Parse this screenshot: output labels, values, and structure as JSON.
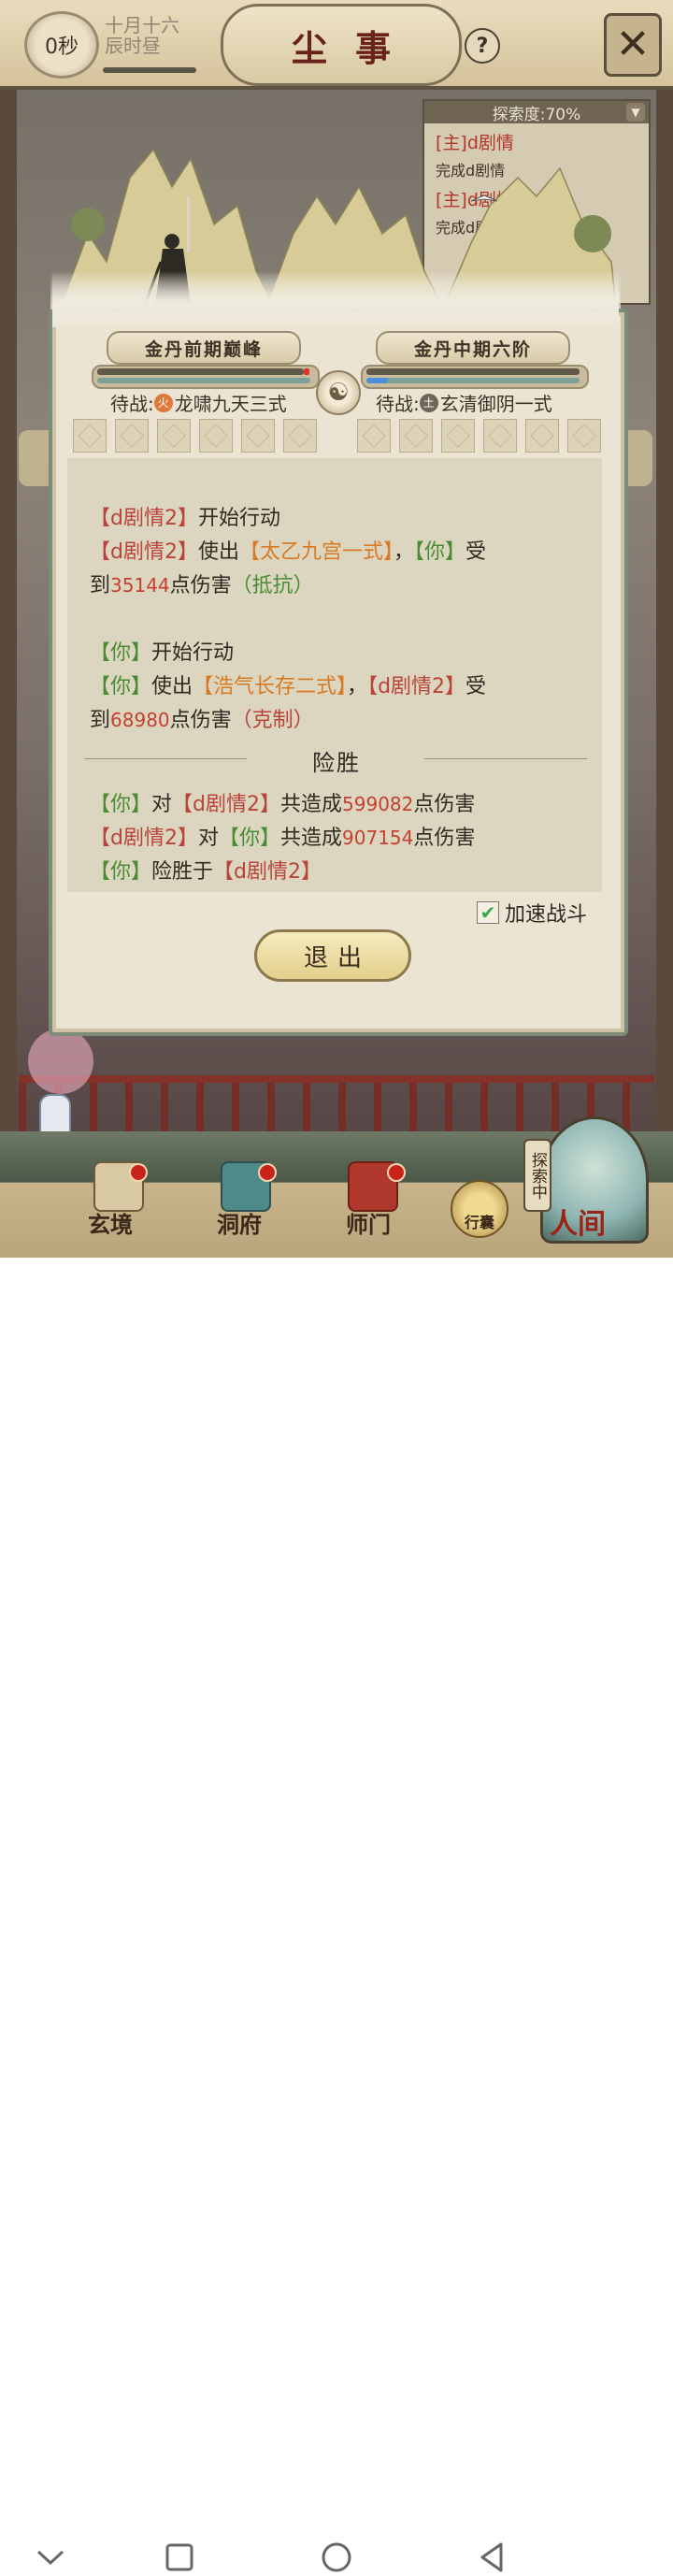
{
  "header": {
    "timer": "0秒",
    "date_line1": "十月十六",
    "date_line2": "辰时昼",
    "title": "尘事",
    "help": "?",
    "close": "✕"
  },
  "explore": {
    "progress_label": "探索度:70%",
    "quests": [
      {
        "tag": "[主]d剧情",
        "desc": "完成d剧情"
      },
      {
        "tag": "[主]d剧情",
        "desc": "完成d剧情"
      }
    ]
  },
  "battle": {
    "left_realm": "金丹前期巅峰",
    "right_realm": "金丹中期六阶",
    "left_hp_fraction": 0.97,
    "right_hp_fraction": 1.0,
    "left_mp_fraction": 0.0,
    "right_mp_fraction": 0.1,
    "left_standby_label": "待战:",
    "left_element": "火",
    "left_skill": "龙啸九天三式",
    "right_standby_label": "待战:",
    "right_element": "土",
    "right_skill": "玄清御阴一式"
  },
  "log": {
    "l1_a": "【d剧情2】",
    "l1_b": "开始行动",
    "l2_a": "【d剧情2】",
    "l2_b": "使出",
    "l2_c": "【太乙九宫一式】",
    "l2_d": "，",
    "l2_e": "【你】",
    "l2_f": "受",
    "l3_a": "到",
    "l3_b": "35144",
    "l3_c": "点伤害",
    "l3_d": "（抵抗）",
    "l4_a": "【你】",
    "l4_b": "开始行动",
    "l5_a": "【你】",
    "l5_b": "使出",
    "l5_c": "【浩气长存二式】",
    "l5_d": "，",
    "l5_e": "【d剧情2】",
    "l5_f": "受",
    "l6_a": "到",
    "l6_b": "68980",
    "l6_c": "点伤害",
    "l6_d": "（克制）",
    "result_title": "险胜",
    "s1_a": "【你】",
    "s1_b": "对",
    "s1_c": "【d剧情2】",
    "s1_d": "共造成",
    "s1_e": "599082",
    "s1_f": "点伤害",
    "s2_a": "【d剧情2】",
    "s2_b": "对",
    "s2_c": "【你】",
    "s2_d": "共造成",
    "s2_e": "907154",
    "s2_f": "点伤害",
    "s3_a": "【你】",
    "s3_b": "险胜于",
    "s3_c": "【d剧情2】"
  },
  "controls": {
    "speed_label": "加速战斗",
    "speed_checked": true,
    "exit_label": "退出"
  },
  "nav": {
    "items": [
      "玄境",
      "洞府",
      "师门"
    ],
    "bag": "行囊",
    "explore_vertical": "探索中",
    "world": "人间"
  },
  "colors": {
    "enemy_name": "#b8443a",
    "player_name": "#4a8c34",
    "skill": "#d87a24",
    "damage": "#c6402f"
  }
}
